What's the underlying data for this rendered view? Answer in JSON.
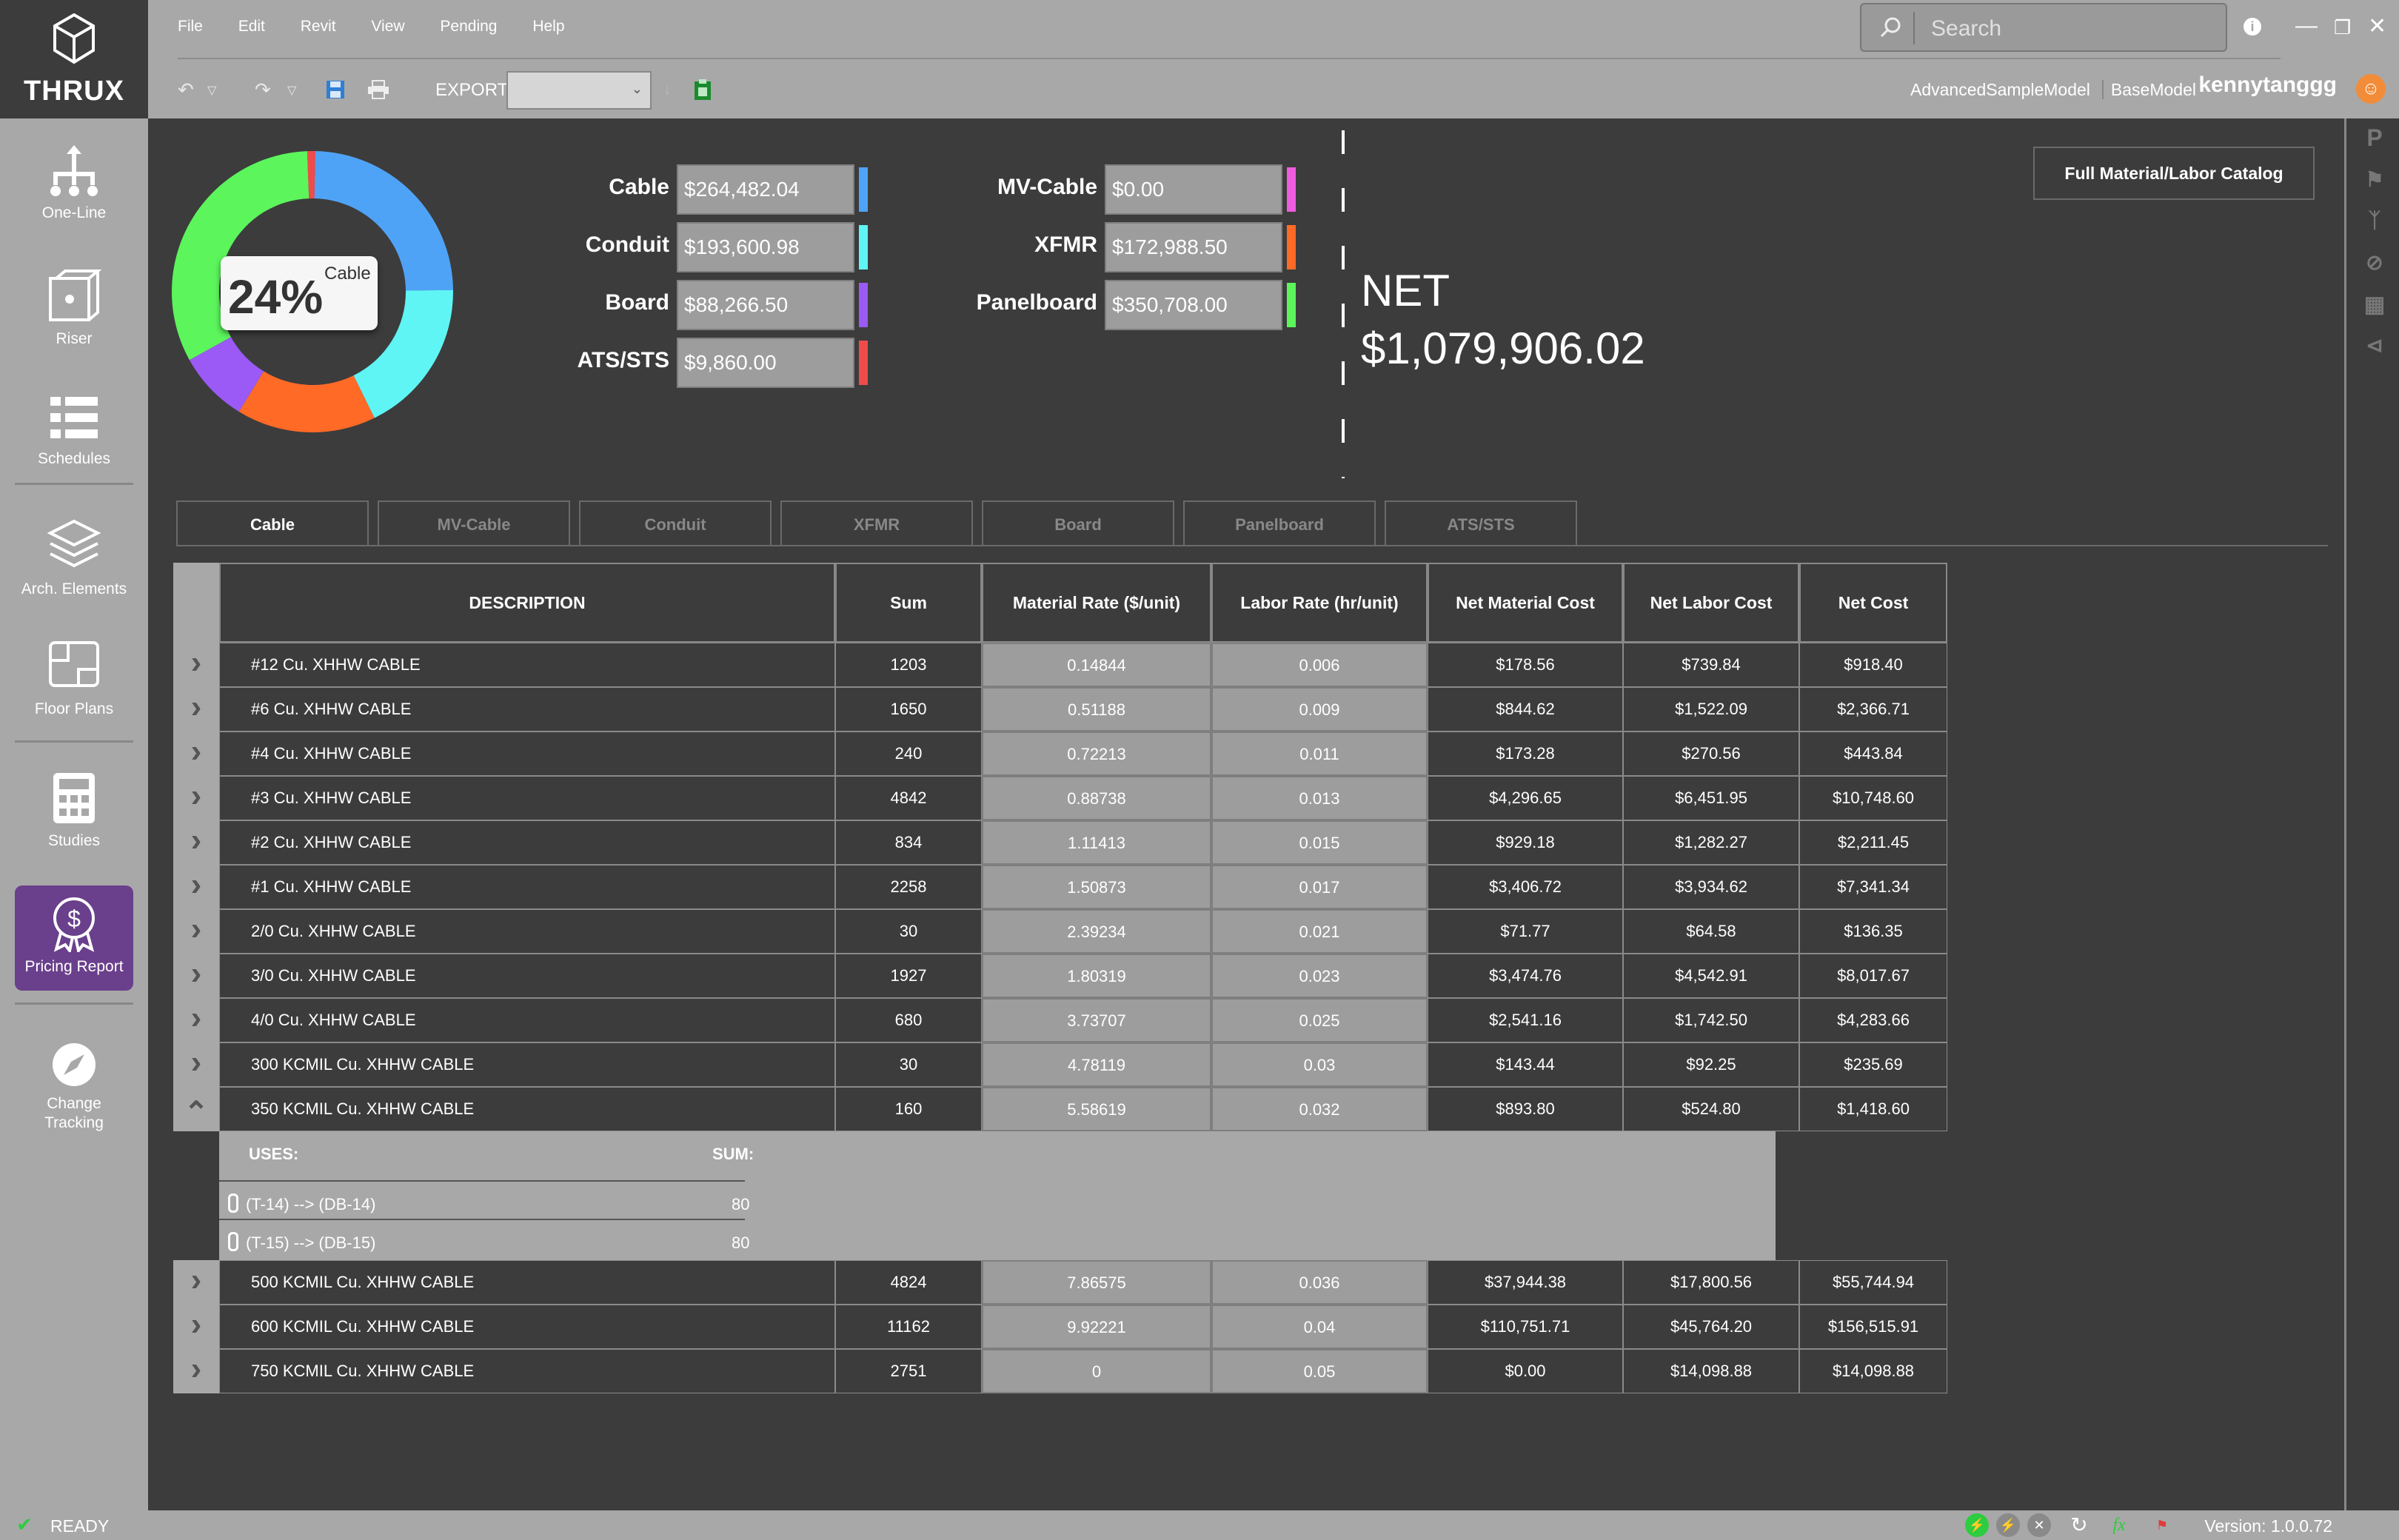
{
  "app": {
    "brand": "THRUX"
  },
  "menu": [
    "File",
    "Edit",
    "Revit",
    "View",
    "Pending",
    "Help"
  ],
  "search": {
    "placeholder": "Search"
  },
  "toolbar": {
    "export_label": "EXPORT",
    "export_value": ""
  },
  "project": {
    "model": "AdvancedSampleModel",
    "base": "BaseModel",
    "user": "kennytanggg"
  },
  "sidebar": {
    "items": [
      {
        "label": "One-Line",
        "icon": "one-line-icon"
      },
      {
        "label": "Riser",
        "icon": "riser-icon"
      },
      {
        "label": "Schedules",
        "icon": "schedules-icon"
      },
      {
        "label": "Arch. Elements",
        "icon": "arch-elements-icon"
      },
      {
        "label": "Floor Plans",
        "icon": "floor-plans-icon"
      },
      {
        "label": "Studies",
        "icon": "studies-icon"
      },
      {
        "label": "Pricing Report",
        "icon": "pricing-report-icon",
        "active": true
      },
      {
        "label": "Change Tracking",
        "icon": "change-tracking-icon"
      }
    ]
  },
  "summary": {
    "donut": {
      "percent": "24%",
      "label": "Cable"
    },
    "costs_left": [
      {
        "label": "Cable",
        "value": "$264,482.04",
        "color": "#4fa3f7"
      },
      {
        "label": "Conduit",
        "value": "$193,600.98",
        "color": "#5ff5f5"
      },
      {
        "label": "Board",
        "value": "$88,266.50",
        "color": "#9b59f5"
      },
      {
        "label": "ATS/STS",
        "value": "$9,860.00",
        "color": "#f04b4b"
      }
    ],
    "costs_right": [
      {
        "label": "MV-Cable",
        "value": "$0.00",
        "color": "#f05ce0"
      },
      {
        "label": "XFMR",
        "value": "$172,988.50",
        "color": "#ff6a26"
      },
      {
        "label": "Panelboard",
        "value": "$350,708.00",
        "color": "#5cf55c"
      }
    ],
    "net_label": "NET",
    "net_value": "$1,079,906.02",
    "catalog_button": "Full Material/Labor Catalog"
  },
  "tabs": [
    "Cable",
    "MV-Cable",
    "Conduit",
    "XFMR",
    "Board",
    "Panelboard",
    "ATS/STS"
  ],
  "table": {
    "headers": [
      "DESCRIPTION",
      "Sum",
      "Material Rate ($/unit)",
      "Labor Rate (hr/unit)",
      "Net Material Cost",
      "Net Labor Cost",
      "Net Cost"
    ],
    "rows": [
      [
        "#12 Cu. XHHW CABLE",
        "1203",
        "0.14844",
        "0.006",
        "$178.56",
        "$739.84",
        "$918.40"
      ],
      [
        "#6 Cu. XHHW CABLE",
        "1650",
        "0.51188",
        "0.009",
        "$844.62",
        "$1,522.09",
        "$2,366.71"
      ],
      [
        "#4 Cu. XHHW CABLE",
        "240",
        "0.72213",
        "0.011",
        "$173.28",
        "$270.56",
        "$443.84"
      ],
      [
        "#3 Cu. XHHW CABLE",
        "4842",
        "0.88738",
        "0.013",
        "$4,296.65",
        "$6,451.95",
        "$10,748.60"
      ],
      [
        "#2 Cu. XHHW CABLE",
        "834",
        "1.11413",
        "0.015",
        "$929.18",
        "$1,282.27",
        "$2,211.45"
      ],
      [
        "#1 Cu. XHHW CABLE",
        "2258",
        "1.50873",
        "0.017",
        "$3,406.72",
        "$3,934.62",
        "$7,341.34"
      ],
      [
        "2/0 Cu. XHHW CABLE",
        "30",
        "2.39234",
        "0.021",
        "$71.77",
        "$64.58",
        "$136.35"
      ],
      [
        "3/0 Cu. XHHW CABLE",
        "1927",
        "1.80319",
        "0.023",
        "$3,474.76",
        "$4,542.91",
        "$8,017.67"
      ],
      [
        "4/0 Cu. XHHW CABLE",
        "680",
        "3.73707",
        "0.025",
        "$2,541.16",
        "$1,742.50",
        "$4,283.66"
      ],
      [
        "300 KCMIL Cu. XHHW CABLE",
        "30",
        "4.78119",
        "0.03",
        "$143.44",
        "$92.25",
        "$235.69"
      ],
      [
        "350 KCMIL Cu. XHHW CABLE",
        "160",
        "5.58619",
        "0.032",
        "$893.80",
        "$524.80",
        "$1,418.60"
      ],
      [
        "500 KCMIL Cu. XHHW CABLE",
        "4824",
        "7.86575",
        "0.036",
        "$37,944.38",
        "$17,800.56",
        "$55,744.94"
      ],
      [
        "600 KCMIL Cu. XHHW CABLE",
        "11162",
        "9.92221",
        "0.04",
        "$110,751.71",
        "$45,764.20",
        "$156,515.91"
      ],
      [
        "750 KCMIL Cu. XHHW CABLE",
        "2751",
        "0",
        "0.05",
        "$0.00",
        "$14,098.88",
        "$14,098.88"
      ]
    ],
    "expanded_row": 10,
    "uses": {
      "uses_header": "USES:",
      "sum_header": "SUM:",
      "items": [
        {
          "path": "(T-14) --> (DB-14)",
          "sum": "80"
        },
        {
          "path": "(T-15) --> (DB-15)",
          "sum": "80"
        }
      ]
    }
  },
  "status": {
    "text": "READY",
    "version": "Version: 1.0.0.72",
    "fx": "fx"
  }
}
